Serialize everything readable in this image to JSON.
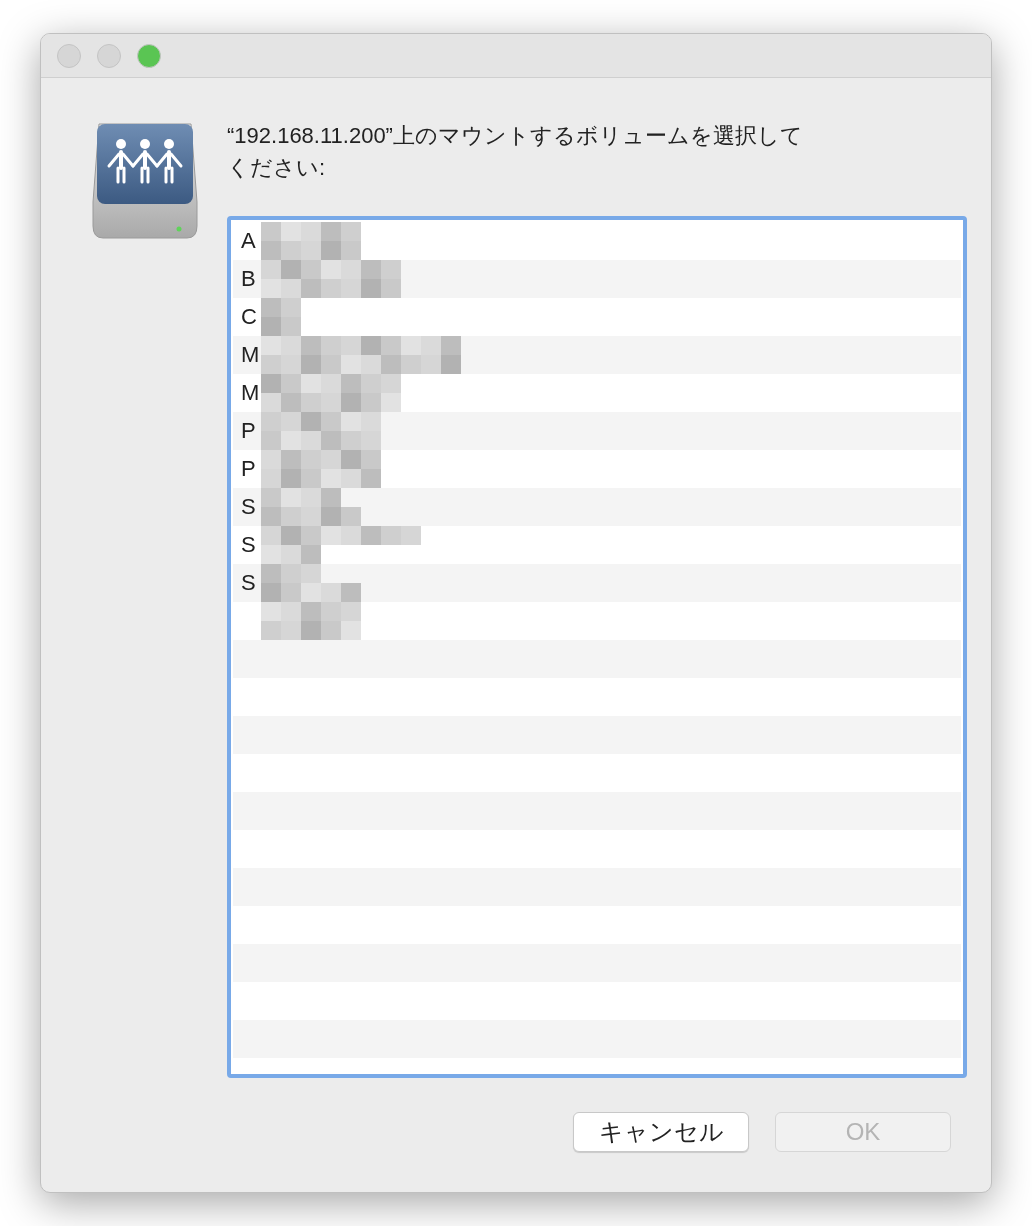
{
  "window": {
    "traffic_lights": [
      {
        "kind": "close",
        "disabled": true
      },
      {
        "kind": "minimize",
        "disabled": true
      },
      {
        "kind": "zoom",
        "disabled": false
      }
    ]
  },
  "prompt": "“192.168.11.200”上のマウントするボリュームを選択してください:",
  "volumes": [
    {
      "kind": "text",
      "label": "A",
      "selected": false
    },
    {
      "kind": "text",
      "label": "B",
      "selected": false
    },
    {
      "kind": "text",
      "label": "C",
      "selected": false
    },
    {
      "kind": "text",
      "label": "M",
      "selected": false
    },
    {
      "kind": "text",
      "label": "M",
      "selected": false
    },
    {
      "kind": "text",
      "label": "P",
      "selected": false
    },
    {
      "kind": "text",
      "label": "P",
      "selected": false
    },
    {
      "kind": "text",
      "label": "S",
      "selected": false
    },
    {
      "kind": "text",
      "label": "S",
      "selected": false
    },
    {
      "kind": "text",
      "label": "S",
      "selected": false
    },
    {
      "kind": "obscured",
      "selected": false
    }
  ],
  "buttons": [
    {
      "label": "キャンセル",
      "disabled": false
    },
    {
      "label": "OK",
      "disabled": true
    }
  ]
}
